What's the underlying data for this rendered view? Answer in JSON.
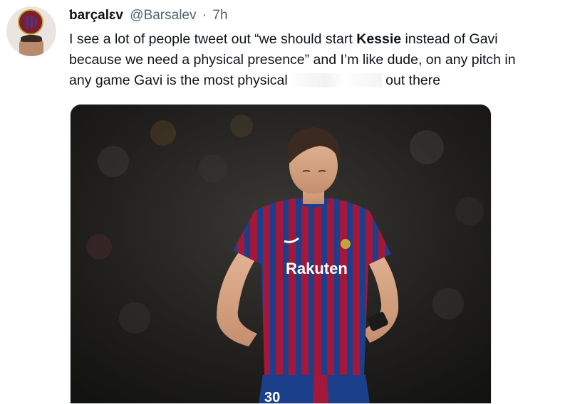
{
  "tweet": {
    "author_name": "ƅarçalɛv",
    "author_handle": "@Barsalev",
    "separator": "·",
    "time": "7h",
    "text_line1_pre": "I see a lot of people tweet out “we should start ",
    "text_line1_bold": "Kessie",
    "text_line1_post": " instead of Gavi",
    "text_line2": "because we need a physical presence” and I’m like dude, on any pitch in",
    "text_line3_pre": "any game  Gavi is the most physical",
    "text_line3_post": " out there"
  },
  "media": {
    "sponsor_text": "Rakuten",
    "shorts_number": "30",
    "icon": "photo-of-player"
  },
  "colors": {
    "text": "#0f1419",
    "muted": "#536471",
    "kit_red": "#a3173a",
    "kit_blue": "#1b3f8b"
  }
}
